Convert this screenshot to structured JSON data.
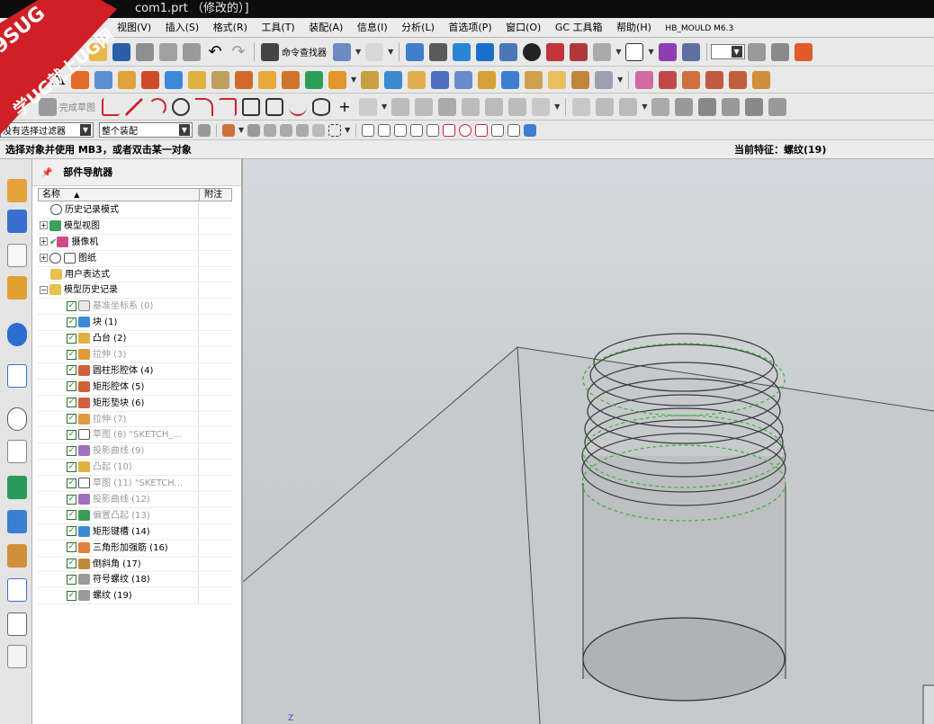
{
  "window": {
    "title": "com1.prt （修改的）]"
  },
  "menu": [
    "视图(V)",
    "插入(S)",
    "格式(R)",
    "工具(T)",
    "装配(A)",
    "信息(I)",
    "分析(L)",
    "首选项(P)",
    "窗口(O)",
    "GC 工具箱",
    "帮助(H)",
    "HB_MOULD M6.3"
  ],
  "toolbar": {
    "command_finder_label": "命令查找器",
    "finish_sketch_label": "完成草图",
    "filter_select": "没有选择过滤器",
    "scope_select": "整个装配"
  },
  "status": {
    "prompt": "选择对象并使用 MB3，或者双击某一对象",
    "current_feature": "当前特征：螺纹(19)"
  },
  "navigator": {
    "title": "部件导航器",
    "col_name": "名称",
    "col_note": "附注",
    "rows": [
      {
        "label": "历史记录模式"
      },
      {
        "label": "模型视图"
      },
      {
        "label": "摄像机"
      },
      {
        "label": "图纸"
      },
      {
        "label": "用户表达式"
      },
      {
        "label": "模型历史记录"
      },
      {
        "label": "基准坐标系 (0)"
      },
      {
        "label": "块 (1)"
      },
      {
        "label": "凸台 (2)"
      },
      {
        "label": "拉伸 (3)"
      },
      {
        "label": "圆柱形腔体 (4)"
      },
      {
        "label": "矩形腔体 (5)"
      },
      {
        "label": "矩形垫块 (6)"
      },
      {
        "label": "拉伸 (7)"
      },
      {
        "label": "草图 (8) \"SKETCH_..."
      },
      {
        "label": "投影曲线 (9)"
      },
      {
        "label": "凸起 (10)"
      },
      {
        "label": "草图 (11) \"SKETCH..."
      },
      {
        "label": "投影曲线 (12)"
      },
      {
        "label": "偏置凸起 (13)"
      },
      {
        "label": "矩形键槽 (14)"
      },
      {
        "label": "三角形加强筋 (16)"
      },
      {
        "label": "倒斜角 (17)"
      },
      {
        "label": "符号螺纹 (18)"
      },
      {
        "label": "螺纹 (19)"
      }
    ]
  },
  "watermark": {
    "line1": "9SUG",
    "line2": "学UG就上UG网"
  },
  "viewport": {
    "axis_label": "Z"
  }
}
